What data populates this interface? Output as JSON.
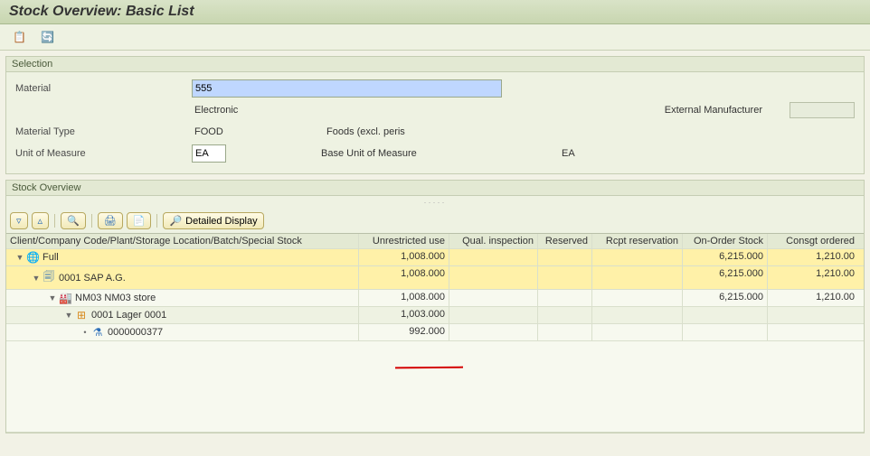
{
  "title": "Stock Overview: Basic List",
  "toolbar": {
    "btn1_title": "Assign",
    "btn2_title": "Refresh"
  },
  "selection": {
    "pane_title": "Selection",
    "material_label": "Material",
    "material_value": "555",
    "material_text": "Electronic",
    "ext_manu_label": "External Manufacturer",
    "mtype_label": "Material Type",
    "mtype_value": "FOOD",
    "mtype_text": "Foods (excl. peris",
    "uom_label": "Unit of Measure",
    "uom_value": "EA",
    "uom_text": "Base Unit of Measure",
    "uom_right": "EA"
  },
  "overview": {
    "pane_title": "Stock Overview",
    "detailed_display": "Detailed Display",
    "columns": {
      "c0": "Client/Company Code/Plant/Storage Location/Batch/Special Stock",
      "c1": "Unrestricted use",
      "c2": "Qual. inspection",
      "c3": "Reserved",
      "c4": "Rcpt reservation",
      "c5": "On-Order Stock",
      "c6": "Consgt ordered"
    },
    "rows": [
      {
        "indent": 0,
        "icon": "world",
        "label": "Full",
        "c1": "1,008.000",
        "c5": "6,215.000",
        "c6": "1,210.00",
        "hl": true
      },
      {
        "indent": 1,
        "icon": "doc",
        "label": "0001 SAP A.G.",
        "c1": "1,008.000",
        "c5": "6,215.000",
        "c6": "1,210.00",
        "hl": true
      },
      {
        "indent": 2,
        "icon": "plant",
        "label": "NM03 NM03 store",
        "c1": "1,008.000",
        "c5": "6,215.000",
        "c6": "1,210.00"
      },
      {
        "indent": 3,
        "icon": "stor",
        "label": "0001 Lager 0001",
        "c1": "1,003.000",
        "alt": true
      },
      {
        "indent": 4,
        "icon": "flask",
        "label": "0000000377",
        "c1": "992.000",
        "leaf": true
      }
    ]
  }
}
